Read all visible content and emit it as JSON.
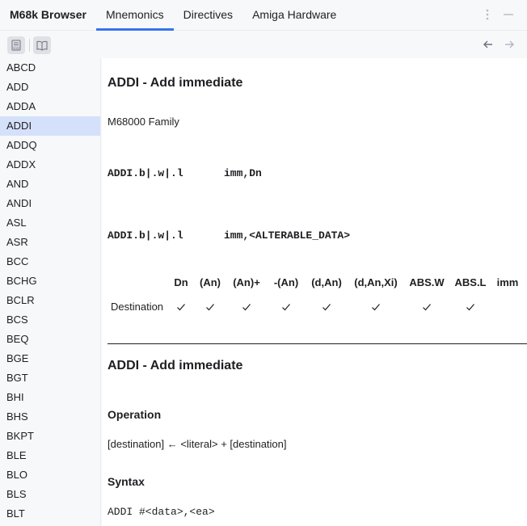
{
  "app": {
    "title": "M68k Browser"
  },
  "tabs": [
    {
      "label": "Mnemonics",
      "active": true
    },
    {
      "label": "Directives",
      "active": false
    },
    {
      "label": "Amiga Hardware",
      "active": false
    }
  ],
  "header_icons": [
    "more-vertical-icon",
    "minimize-icon"
  ],
  "toolbar": {
    "buttons": [
      "binary-view-icon",
      "book-icon"
    ],
    "nav": [
      "back-arrow-icon",
      "forward-arrow-icon"
    ]
  },
  "sidebar": {
    "selected": "ADDI",
    "items": [
      "ABCD",
      "ADD",
      "ADDA",
      "ADDI",
      "ADDQ",
      "ADDX",
      "AND",
      "ANDI",
      "ASL",
      "ASR",
      "BCC",
      "BCHG",
      "BCLR",
      "BCS",
      "BEQ",
      "BGE",
      "BGT",
      "BHI",
      "BHS",
      "BKPT",
      "BLE",
      "BLO",
      "BLS",
      "BLT"
    ]
  },
  "doc": {
    "title": "ADDI - Add immediate",
    "family": "M68000 Family",
    "syntax_lines": [
      {
        "size": "ADDI.b|.w|.l",
        "operands": "imm,Dn"
      },
      {
        "size": "ADDI.b|.w|.l",
        "operands": "imm,<ALTERABLE_DATA>"
      }
    ],
    "ea_table": {
      "columns": [
        "Dn",
        "(An)",
        "(An)+",
        "-(An)",
        "(d,An)",
        "(d,An,Xi)",
        "ABS.W",
        "ABS.L",
        "imm"
      ],
      "rows": [
        {
          "label": "Destination",
          "checks": [
            true,
            true,
            true,
            true,
            true,
            true,
            true,
            true,
            false
          ]
        }
      ]
    },
    "section2_title": "ADDI - Add immediate",
    "operation_heading": "Operation",
    "operation_text": "[destination] ← <literal> + [destination]",
    "syntax_heading": "Syntax",
    "syntax_code": "ADDI #<data>,<ea>"
  },
  "colors": {
    "accent": "#3574f0",
    "selected_bg": "#d5e1fb",
    "panel_bg": "#f7f8fa"
  }
}
